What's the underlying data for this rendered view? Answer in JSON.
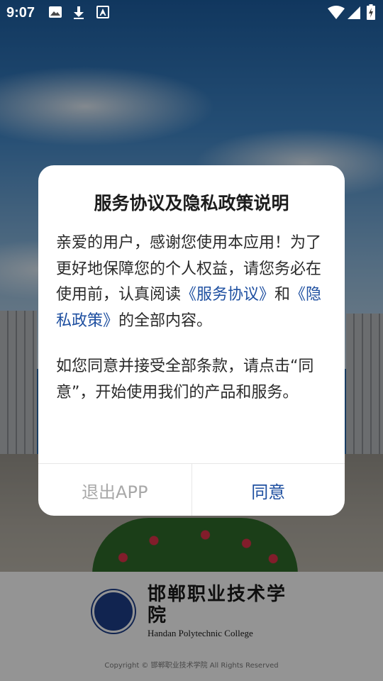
{
  "status_bar": {
    "time": "9:07",
    "left_icons": [
      "image-icon",
      "download-icon",
      "font-a-icon"
    ],
    "right_icons": [
      "wifi-icon",
      "cell-signal-icon",
      "battery-charging-icon"
    ]
  },
  "background": {
    "college_name_cn": "邯郸职业技术学院",
    "college_name_en": "Handan Polytechnic College",
    "copyright": "Copyright © 邯郸职业技术学院 All Rights Reserved"
  },
  "dialog": {
    "title": "服务协议及隐私政策说明",
    "para1_part1": "亲爱的用户，感谢您使用本应用！为了更好地保障您的个人权益，请您务必在使用前，认真阅读",
    "service_agreement_link": "《服务协议》",
    "para1_and": "和",
    "privacy_policy_link": "《隐私政策》",
    "para1_part2": "的全部内容。",
    "para2": "如您同意并接受全部条款，请点击“同意”，开始使用我们的产品和服务。",
    "exit_button": "退出APP",
    "agree_button": "同意"
  },
  "colors": {
    "accent": "#1e4fa0",
    "exit_text": "#a8a8a8",
    "scrim": "rgba(0,0,0,0.42)"
  }
}
